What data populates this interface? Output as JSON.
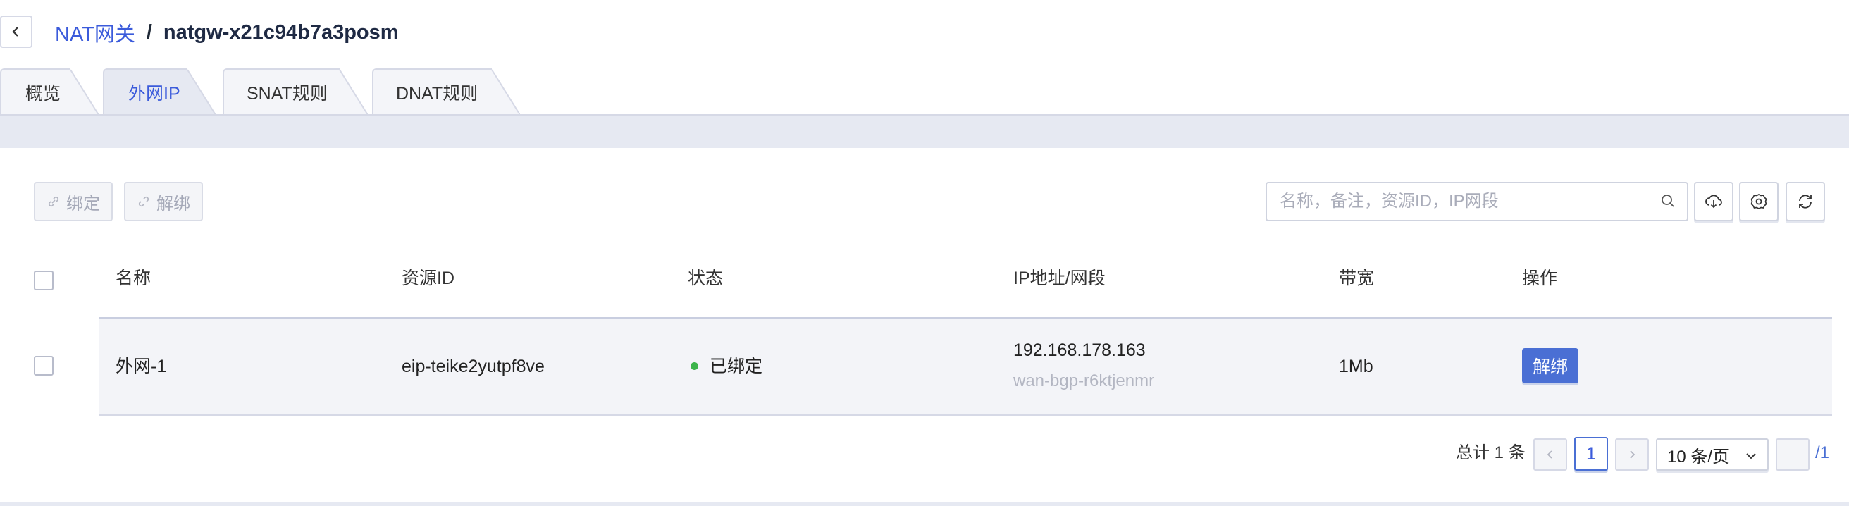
{
  "breadcrumb": {
    "parent": "NAT网关",
    "separator": "/",
    "current": "natgw-x21c94b7a3posm"
  },
  "tabs": [
    {
      "label": "概览",
      "active": false
    },
    {
      "label": "外网IP",
      "active": true
    },
    {
      "label": "SNAT规则",
      "active": false
    },
    {
      "label": "DNAT规则",
      "active": false
    }
  ],
  "toolbar": {
    "bind_label": "绑定",
    "unbind_label": "解绑",
    "search_placeholder": "名称，备注，资源ID，IP网段"
  },
  "table": {
    "headers": [
      "名称",
      "资源ID",
      "状态",
      "IP地址/网段",
      "带宽",
      "操作"
    ],
    "rows": [
      {
        "name": "外网-1",
        "resource_id": "eip-teike2yutpf8ve",
        "status": "已绑定",
        "ip": "192.168.178.163",
        "ip_sub": "wan-bgp-r6ktjenmr",
        "bandwidth": "1Mb",
        "action": "解绑"
      }
    ]
  },
  "pagination": {
    "total_text": "总计 1 条",
    "current_page": "1",
    "page_size": "10 条/页",
    "total_pages": "/1"
  },
  "colors": {
    "accent": "#3b5bdb",
    "button": "#4a6fd4",
    "status_ok": "#3cb44b",
    "band": "#e6e9f2"
  }
}
